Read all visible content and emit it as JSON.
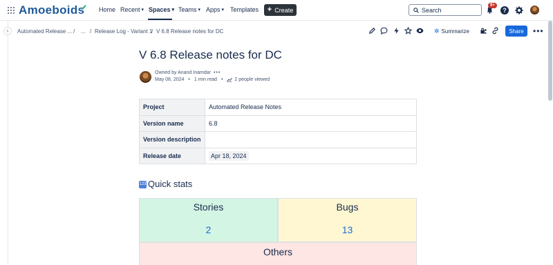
{
  "app": {
    "logo": "Amoeboids"
  },
  "nav": {
    "items": [
      {
        "label": "Home",
        "dropdown": false
      },
      {
        "label": "Recent",
        "dropdown": true
      },
      {
        "label": "Spaces",
        "dropdown": true,
        "active": true
      },
      {
        "label": "Teams",
        "dropdown": true
      },
      {
        "label": "Apps",
        "dropdown": true
      },
      {
        "label": "Templates",
        "dropdown": false
      }
    ],
    "create_label": "Create",
    "search_placeholder": "Search",
    "notification_badge": "9+",
    "help_glyph": "?"
  },
  "breadcrumb": {
    "items": [
      "Automated Release ...",
      "...",
      "Release Log - Variant 1",
      "V 6.8 Release notes for DC"
    ],
    "separator": "/"
  },
  "page_actions": {
    "icons": [
      "edit-icon",
      "comment-icon",
      "lightning-icon",
      "star-icon",
      "watch-icon"
    ],
    "summarize_label": "Summarize",
    "share_label": "Share",
    "more_label": "•••"
  },
  "page": {
    "title": "V 6.8 Release notes for DC",
    "owned_by": "Owned by Anand Inamdar",
    "owner_more": "•••",
    "date": "May 08, 2024",
    "read_time": "1 min read",
    "viewers": "2 people viewed"
  },
  "details_table": [
    {
      "key": "Project",
      "value": "Automated Release Notes",
      "chip": false
    },
    {
      "key": "Version name",
      "value": "6.8",
      "chip": false
    },
    {
      "key": "Version description",
      "value": "",
      "chip": false
    },
    {
      "key": "Release date",
      "value": "Apr 18, 2024",
      "chip": true
    }
  ],
  "quick_stats": {
    "heading": "Quick stats",
    "icon_glyph": "123",
    "stories_label": "Stories",
    "stories_value": "2",
    "bugs_label": "Bugs",
    "bugs_value": "13",
    "others_label": "Others"
  },
  "colors": {
    "accent": "#1868db",
    "stories_bg": "#d3f5e3",
    "bugs_bg": "#fef7d1",
    "others_bg": "#fde6e3",
    "create_bg": "#2c333a",
    "badge": "#c9372c"
  }
}
